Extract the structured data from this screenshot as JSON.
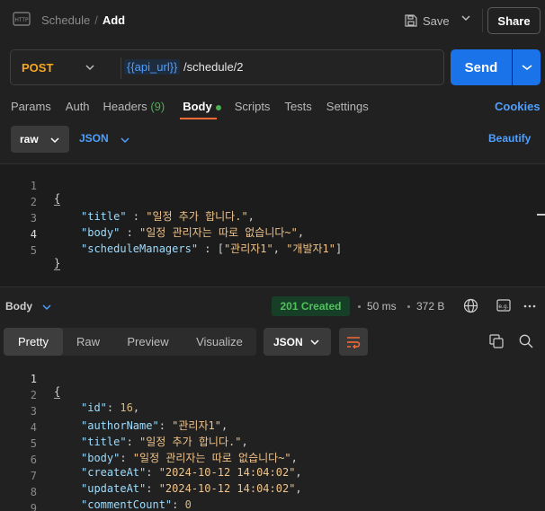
{
  "header": {
    "app_icon": "http-icon",
    "breadcrumb_parent": "Schedule",
    "breadcrumb_sep": "/",
    "breadcrumb_current": "Add",
    "save_label": "Save",
    "share_label": "Share"
  },
  "request": {
    "method": "POST",
    "url_variable": "{{api_url}}",
    "url_path": " /schedule/2",
    "send_label": "Send"
  },
  "tabs": {
    "params": "Params",
    "auth": "Auth",
    "headers": "Headers",
    "headers_count": "(9)",
    "body": "Body",
    "scripts": "Scripts",
    "tests": "Tests",
    "settings": "Settings",
    "cookies": "Cookies"
  },
  "body_options": {
    "mode": "raw",
    "format": "JSON",
    "beautify": "Beautify"
  },
  "request_body": [
    {
      "ln": "1",
      "text": "{"
    },
    {
      "ln": "2",
      "key": "\"title\"",
      "sep": " : ",
      "val": "\"일정 추가 합니다.\"",
      "end": ","
    },
    {
      "ln": "3",
      "key": "\"body\"",
      "sep": " : ",
      "val": "\"일정 관리자는 따로 없습니다~\"",
      "end": ","
    },
    {
      "ln": "4",
      "key": "\"scheduleManagers\"",
      "sep": " : [",
      "val": "\"관리자1\"",
      "mid": ", ",
      "val2": "\"개발자1\"",
      "end": "]"
    },
    {
      "ln": "5",
      "text": "}"
    }
  ],
  "response": {
    "label": "Body",
    "status": "201 Created",
    "time": "50 ms",
    "size": "372 B",
    "tabs": [
      "Pretty",
      "Raw",
      "Preview",
      "Visualize"
    ],
    "format": "JSON",
    "lines": [
      {
        "ln": "1",
        "text": "{"
      },
      {
        "ln": "2",
        "key": "\"id\"",
        "sep": ": ",
        "num": "16",
        "end": ","
      },
      {
        "ln": "3",
        "key": "\"authorName\"",
        "sep": ": ",
        "val": "\"관리자1\"",
        "end": ","
      },
      {
        "ln": "4",
        "key": "\"title\"",
        "sep": ": ",
        "val": "\"일정 추가 합니다.\"",
        "end": ","
      },
      {
        "ln": "5",
        "key": "\"body\"",
        "sep": ": ",
        "val": "\"일정 관리자는 따로 없습니다~\"",
        "end": ","
      },
      {
        "ln": "6",
        "key": "\"createAt\"",
        "sep": ": ",
        "val": "\"2024-10-12 14:04:02\"",
        "end": ","
      },
      {
        "ln": "7",
        "key": "\"updateAt\"",
        "sep": ": ",
        "val": "\"2024-10-12 14:04:02\"",
        "end": ","
      },
      {
        "ln": "8",
        "key": "\"commentCount\"",
        "sep": ": ",
        "num": "0",
        "end": ""
      },
      {
        "ln": "9",
        "text": "}"
      }
    ]
  },
  "colors": {
    "accent": "#ff6c37",
    "send": "#1a73e8",
    "link": "#4e9fff",
    "method_post": "#f5a623",
    "status_ok": "#4fc35a"
  }
}
